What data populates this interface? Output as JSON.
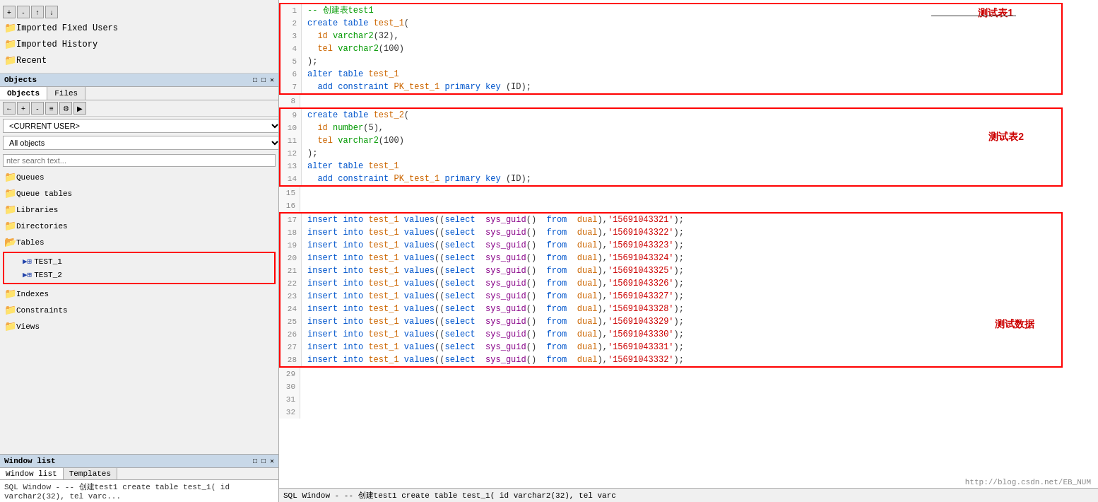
{
  "sidebar": {
    "toolbar_buttons": [
      "+",
      "-",
      "↑",
      "↓",
      "▶",
      "⚙"
    ],
    "items": [
      {
        "label": "Imported Fixed Users",
        "icon": "folder"
      },
      {
        "label": "Imported History",
        "icon": "folder"
      },
      {
        "label": "Recent",
        "icon": "folder"
      }
    ]
  },
  "objects_panel": {
    "title": "Objects",
    "tabs": [
      "Objects",
      "Files"
    ],
    "toolbar_buttons": [
      "←",
      "+",
      "-",
      "≡",
      "⚙",
      "▶"
    ],
    "dropdown": "<CURRENT USER>",
    "dropdown_label": "All objects",
    "search_placeholder": "nter search text...",
    "items": [
      {
        "label": "Queues",
        "indent": 0
      },
      {
        "label": "Queue tables",
        "indent": 0
      },
      {
        "label": "Libraries",
        "indent": 0
      },
      {
        "label": "Directories",
        "indent": 0
      },
      {
        "label": "Tables",
        "indent": 0,
        "expanded": true
      },
      {
        "label": "TEST_1",
        "indent": 1,
        "type": "table",
        "highlighted": true
      },
      {
        "label": "TEST_2",
        "indent": 1,
        "type": "table",
        "highlighted": true
      },
      {
        "label": "Indexes",
        "indent": 0
      },
      {
        "label": "Constraints",
        "indent": 0
      },
      {
        "label": "Views",
        "indent": 0
      }
    ]
  },
  "window_list": {
    "title": "Window list",
    "tabs": [
      "Window list",
      "Templates"
    ],
    "content": "SQL Window - -- 创建test1 create table test_1( id varchar2(32), tel varc..."
  },
  "sql_editor": {
    "sections": [
      {
        "id": "section1",
        "annotation": "测试表1",
        "lines": [
          {
            "num": 1,
            "content": "-- 创建表test1",
            "type": "comment"
          },
          {
            "num": 2,
            "content": "create table test_1("
          },
          {
            "num": 3,
            "content": "  id varchar2(32),"
          },
          {
            "num": 4,
            "content": "  tel varchar2(100)"
          },
          {
            "num": 5,
            "content": ");"
          },
          {
            "num": 6,
            "content": "alter table test_1"
          },
          {
            "num": 7,
            "content": "  add constraint PK_test_1 primary key (ID);"
          }
        ]
      },
      {
        "id": "section2",
        "annotation": "测试表2",
        "lines": [
          {
            "num": 9,
            "content": "create table test_2("
          },
          {
            "num": 10,
            "content": "  id number(5),"
          },
          {
            "num": 11,
            "content": "  tel varchar2(100)"
          },
          {
            "num": 12,
            "content": ");"
          },
          {
            "num": 13,
            "content": "alter table test_1"
          },
          {
            "num": 14,
            "content": "  add constraint PK_test_1 primary key (ID);"
          }
        ]
      },
      {
        "id": "section3",
        "annotation": "测试数据",
        "lines": [
          {
            "num": 17,
            "content": "insert into test_1 values((select  sys_guid()  from  dual),'15691043321');"
          },
          {
            "num": 18,
            "content": "insert into test_1 values((select  sys_guid()  from  dual),'15691043322');"
          },
          {
            "num": 19,
            "content": "insert into test_1 values((select  sys_guid()  from  dual),'15691043323');"
          },
          {
            "num": 20,
            "content": "insert into test_1 values((select  sys_guid()  from  dual),'15691043324');"
          },
          {
            "num": 21,
            "content": "insert into test_1 values((select  sys_guid()  from  dual),'15691043325');"
          },
          {
            "num": 22,
            "content": "insert into test_1 values((select  sys_guid()  from  dual),'15691043326');"
          },
          {
            "num": 23,
            "content": "insert into test_1 values((select  sys_guid()  from  dual),'15691043327');"
          },
          {
            "num": 24,
            "content": "insert into test_1 values((select  sys_guid()  from  dual),'15691043328');"
          },
          {
            "num": 25,
            "content": "insert into test_1 values((select  sys_guid()  from  dual),'15691043329');"
          },
          {
            "num": 26,
            "content": "insert into test_1 values((select  sys_guid()  from  dual),'15691043330');"
          },
          {
            "num": 27,
            "content": "insert into test_1 values((select  sys_guid()  from  dual),'15691043331');"
          },
          {
            "num": 28,
            "content": "insert into test_1 values((select  sys_guid()  from  dual),'15691043332');"
          }
        ]
      }
    ],
    "blank_lines": [
      8,
      15,
      16,
      29,
      30,
      31,
      32
    ],
    "footer_url": "http://blog.csdn.net/EB_NUM"
  },
  "status_bar": {
    "text": "SQL Window - -- 创建test1 create table test_1( id varchar2(32), tel varc"
  }
}
